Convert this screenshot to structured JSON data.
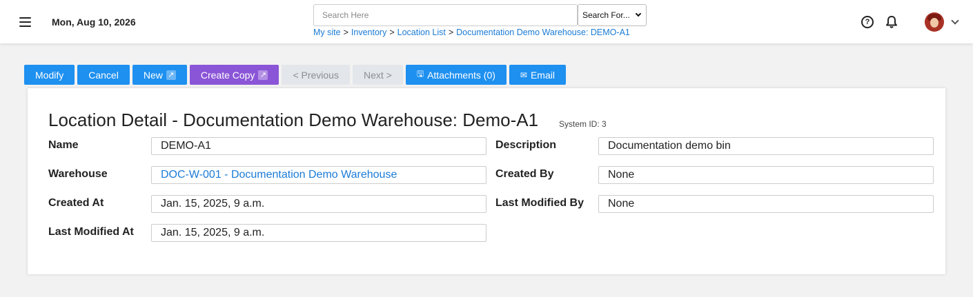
{
  "header": {
    "date": "Mon, Aug 10, 2026",
    "search": {
      "placeholder": "Search Here",
      "value": ""
    },
    "search_select": "Search For...",
    "breadcrumb": [
      "My site",
      "Inventory",
      "Location List",
      "Documentation Demo Warehouse: DEMO-A1"
    ],
    "help_glyph": "?"
  },
  "toolbar": {
    "modify": "Modify",
    "cancel": "Cancel",
    "new": "New",
    "create_copy": "Create Copy",
    "previous": "< Previous",
    "next": "Next >",
    "attachments": "Attachments (0)",
    "email": "Email",
    "ext_glyph": "↗",
    "attachment_glyph": "🖫",
    "email_glyph": "✉"
  },
  "detail": {
    "title": "Location Detail - Documentation Demo Warehouse: Demo-A1",
    "system_id": "System ID: 3",
    "fields": {
      "name_label": "Name",
      "name": "DEMO-A1",
      "description_label": "Description",
      "description": "Documentation demo bin",
      "warehouse_label": "Warehouse",
      "warehouse": "DOC-W-001 - Documentation Demo Warehouse",
      "created_by_label": "Created By",
      "created_by": "None",
      "created_at_label": "Created At",
      "created_at": "Jan. 15, 2025, 9 a.m.",
      "last_modified_by_label": "Last Modified By",
      "last_modified_by": "None",
      "last_modified_at_label": "Last Modified At",
      "last_modified_at": "Jan. 15, 2025, 9 a.m."
    }
  },
  "icons": [
    "menu-icon",
    "help-icon",
    "bell-icon",
    "avatar",
    "chevron-down-icon",
    "external-link-icon",
    "attachment-icon",
    "email-icon"
  ],
  "colors": {
    "primary": "#1e90f0",
    "purple": "#8a55d6",
    "link": "#1a7bd6",
    "disabled_bg": "#e3e6ea"
  }
}
